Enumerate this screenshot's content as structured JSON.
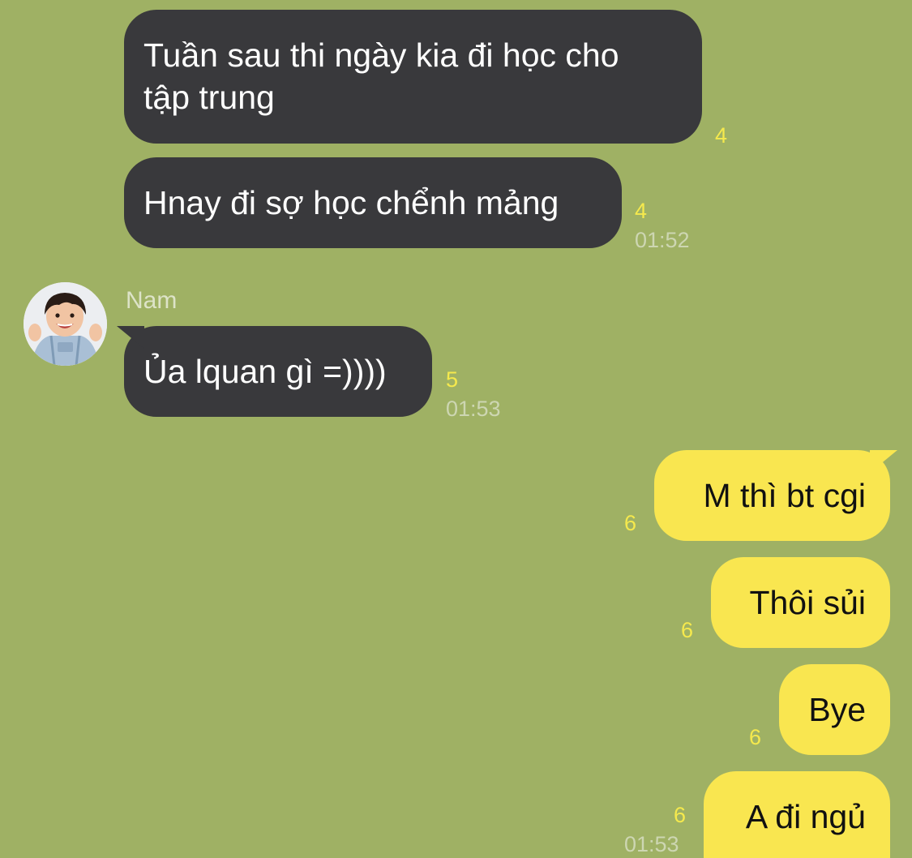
{
  "sender_name": "Nam",
  "messages": [
    {
      "text": "Tuần sau thi ngày kia đi học cho\ntập trung",
      "read_count": "4"
    },
    {
      "text": "Hnay đi sợ học chểnh mảng",
      "read_count": "4",
      "time": "01:52"
    },
    {
      "text": "Ủa lquan gì =))))",
      "read_count": "5",
      "time": "01:53"
    },
    {
      "text": "M thì bt cgi",
      "read_count": "6"
    },
    {
      "text": "Thôi sủi",
      "read_count": "6"
    },
    {
      "text": "Bye",
      "read_count": "6"
    },
    {
      "text": "A đi ngủ",
      "read_count": "6",
      "time": "01:53"
    }
  ],
  "colors": {
    "background": "#9fb164",
    "incoming_bubble": "#39393c",
    "outgoing_bubble": "#f9e650",
    "read_count": "#f5e94d"
  }
}
